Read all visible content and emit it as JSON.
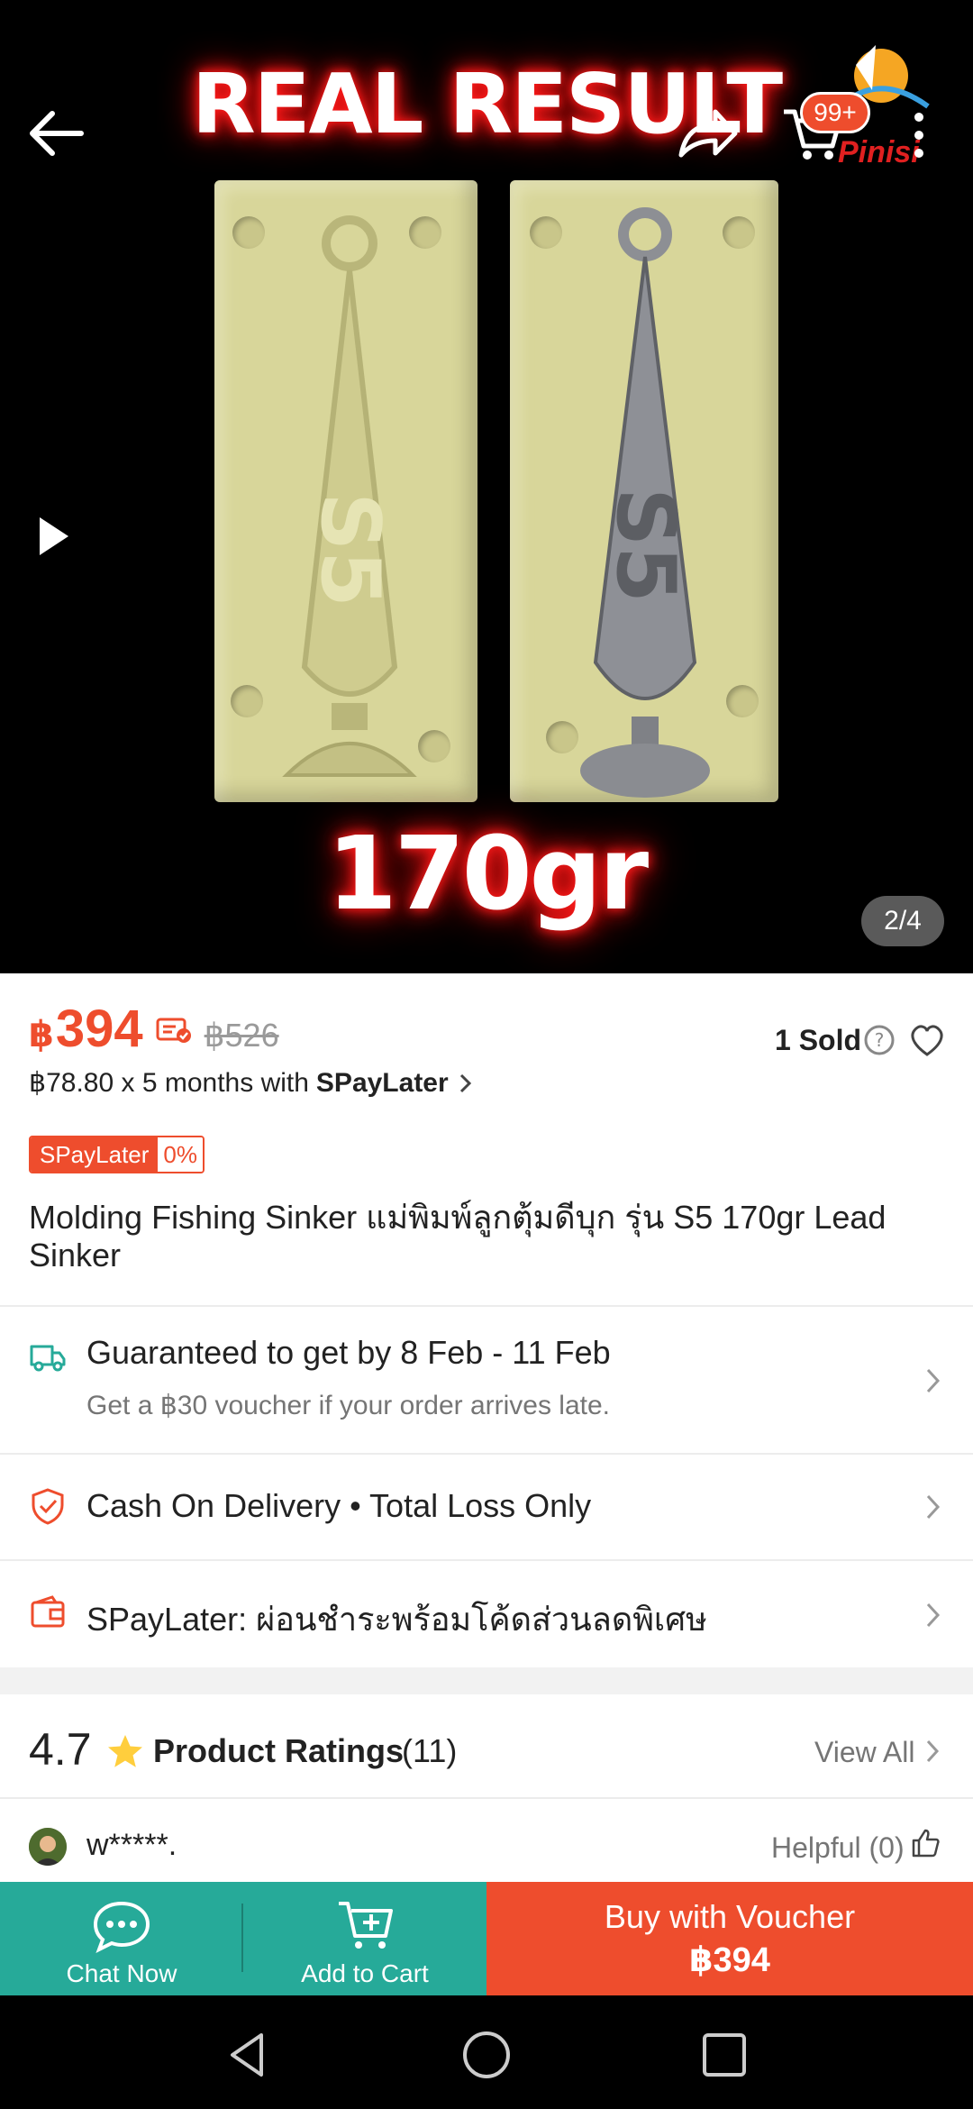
{
  "hero": {
    "title": "REAL RESULT",
    "weight": "170gr",
    "logo_text": "Pinisi",
    "cart_badge": "99+",
    "page_indicator": "2/4"
  },
  "price": {
    "currency": "฿",
    "current": "394",
    "original": "฿526",
    "sold": "1 Sold",
    "installment": "฿78.80 x 5 months with",
    "installment_brand": "SPayLater"
  },
  "badge": {
    "label": "SPayLater",
    "rate": "0%"
  },
  "product": {
    "title": "Molding Fishing Sinker แม่พิมพ์ลูกตุ้มดีบุก รุ่น S5 170gr Lead Sinker"
  },
  "shipping": {
    "title": "Guaranteed to get by 8 Feb - 11 Feb",
    "subtitle": "Get a ฿30 voucher if your order arrives late."
  },
  "payment": {
    "text": "Cash On Delivery • Total Loss Only"
  },
  "spaylater_row": {
    "text": "SPayLater: ผ่อนชำระพร้อมโค้ดส่วนลดพิเศษ"
  },
  "ratings": {
    "score": "4.7",
    "label": "Product Ratings",
    "count": "(11)",
    "view_all": "View All"
  },
  "review": {
    "user": "w*****.",
    "helpful": "Helpful (0)"
  },
  "bottom_bar": {
    "chat_label": "Chat Now",
    "cart_label": "Add to Cart",
    "buy_label": "Buy with Voucher",
    "buy_price": "฿394"
  },
  "colors": {
    "accent": "#ee4d2d",
    "teal": "#26aa99"
  },
  "icons": [
    "back-arrow-icon",
    "share-icon",
    "cart-icon",
    "more-icon",
    "play-icon",
    "voucher-icon",
    "help-icon",
    "heart-icon",
    "truck-icon",
    "shield-icon",
    "wallet-icon",
    "star-icon",
    "thumb-up-icon",
    "chat-icon",
    "add-cart-icon"
  ]
}
